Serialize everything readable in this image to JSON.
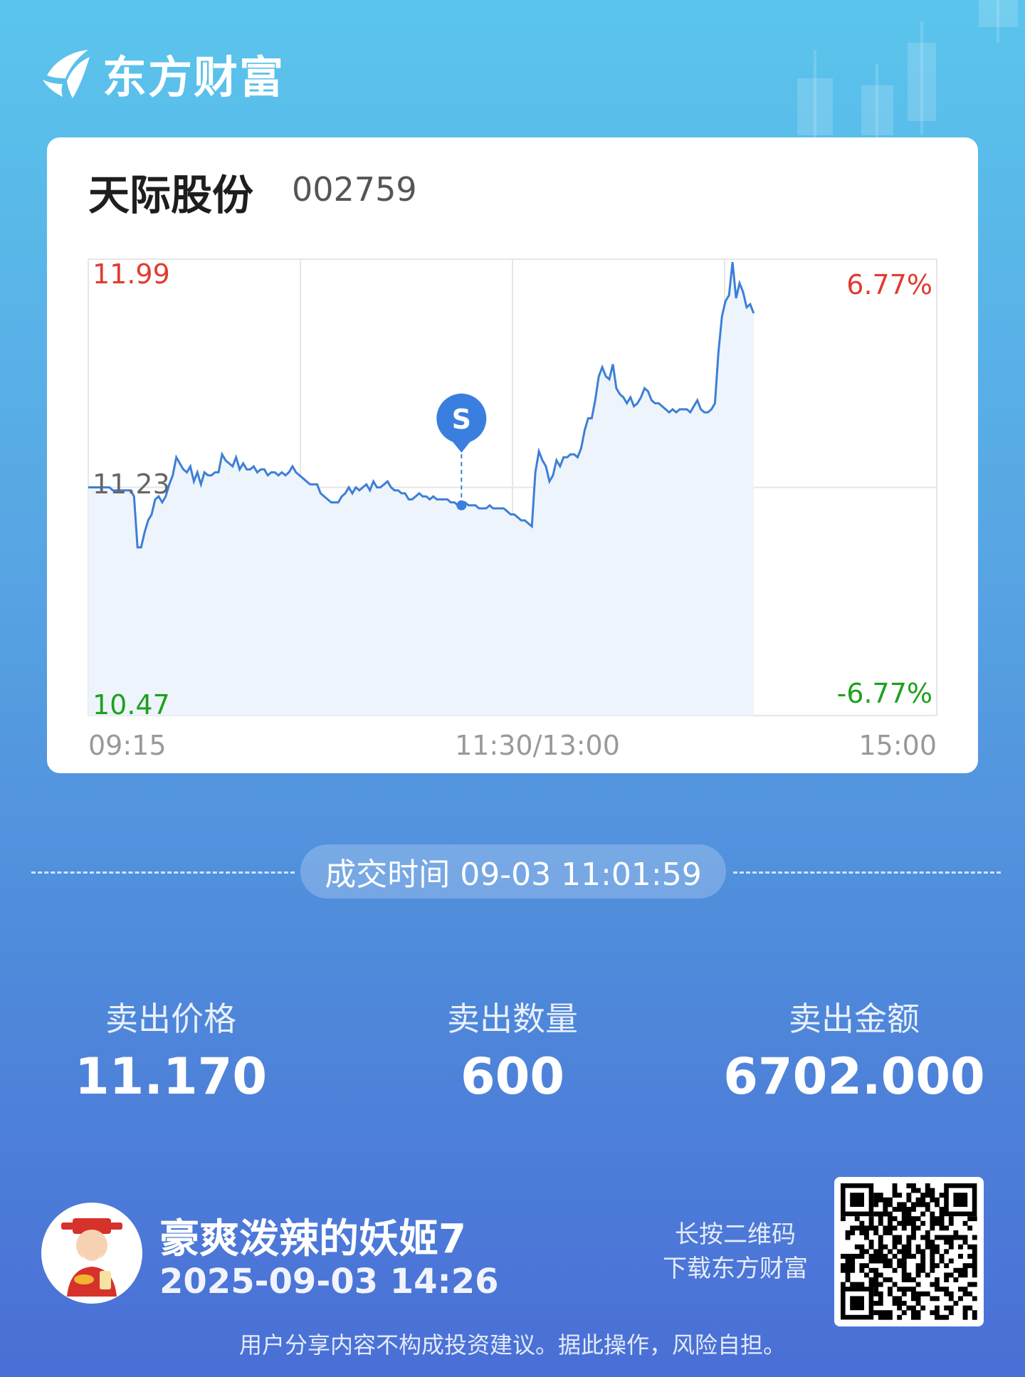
{
  "brand": {
    "name": "东方财富",
    "logo_icon": "eastmoney-logo-icon"
  },
  "stock": {
    "name": "天际股份",
    "code": "002759"
  },
  "chart_data": {
    "type": "line",
    "title": "",
    "y_max_label": "11.99",
    "y_mid_label": "11.23",
    "y_min_label": "10.47",
    "pct_max_label": "6.77%",
    "pct_min_label": "-6.77%",
    "x_tick_labels": [
      "09:15",
      "11:30/13:00",
      "15:00"
    ],
    "ylim": [
      10.47,
      11.99
    ],
    "reference_price": 11.23,
    "colors": {
      "line": "#3d7fd6",
      "fill": "#eef4fc",
      "up": "#e03c31",
      "down": "#1ea11e",
      "grid": "#e6e6e6"
    },
    "marker": {
      "label": "S",
      "time_index": 106,
      "price": 11.17,
      "color": "#3a7fe0"
    },
    "series": [
      {
        "values": [
          11.23,
          11.23,
          11.23,
          11.23,
          11.23,
          11.23,
          11.23,
          11.22,
          11.22,
          11.22,
          11.22,
          11.22,
          11.22,
          11.2,
          11.03,
          11.03,
          11.08,
          11.12,
          11.14,
          11.19,
          11.2,
          11.18,
          11.2,
          11.24,
          11.27,
          11.33,
          11.31,
          11.29,
          11.28,
          11.3,
          11.25,
          11.28,
          11.24,
          11.28,
          11.27,
          11.27,
          11.28,
          11.28,
          11.34,
          11.32,
          11.31,
          11.3,
          11.33,
          11.29,
          11.31,
          11.29,
          11.29,
          11.3,
          11.28,
          11.29,
          11.29,
          11.27,
          11.28,
          11.28,
          11.27,
          11.28,
          11.27,
          11.28,
          11.3,
          11.28,
          11.27,
          11.26,
          11.25,
          11.24,
          11.24,
          11.24,
          11.21,
          11.2,
          11.19,
          11.18,
          11.18,
          11.18,
          11.2,
          11.21,
          11.23,
          11.21,
          11.23,
          11.22,
          11.23,
          11.24,
          11.22,
          11.25,
          11.23,
          11.23,
          11.24,
          11.25,
          11.23,
          11.22,
          11.22,
          11.21,
          11.21,
          11.19,
          11.19,
          11.2,
          11.21,
          11.2,
          11.2,
          11.19,
          11.2,
          11.19,
          11.19,
          11.19,
          11.19,
          11.18,
          11.18,
          11.17,
          11.17,
          11.18,
          11.17,
          11.17,
          11.17,
          11.16,
          11.16,
          11.16,
          11.17,
          11.16,
          11.16,
          11.16,
          11.16,
          11.15,
          11.14,
          11.14,
          11.13,
          11.12,
          11.12,
          11.11,
          11.1,
          11.28,
          11.35,
          11.32,
          11.3,
          11.25,
          11.27,
          11.32,
          11.3,
          11.33,
          11.33,
          11.34,
          11.34,
          11.33,
          11.36,
          11.42,
          11.46,
          11.46,
          11.52,
          11.6,
          11.63,
          11.6,
          11.59,
          11.64,
          11.56,
          11.54,
          11.53,
          11.51,
          11.53,
          11.5,
          11.51,
          11.53,
          11.56,
          11.55,
          11.52,
          11.51,
          11.51,
          11.5,
          11.49,
          11.48,
          11.49,
          11.48,
          11.49,
          11.49,
          11.49,
          11.48,
          11.5,
          11.52,
          11.49,
          11.48,
          11.48,
          11.49,
          11.51,
          11.68,
          11.8,
          11.85,
          11.87,
          11.98,
          11.86,
          11.91,
          11.88,
          11.83,
          11.84,
          11.81
        ]
      }
    ]
  },
  "trade_time": "成交时间 09-03 11:01:59",
  "stats": [
    {
      "label": "卖出价格",
      "value": "11.170"
    },
    {
      "label": "卖出数量",
      "value": "600"
    },
    {
      "label": "卖出金额",
      "value": "6702.000"
    }
  ],
  "user": {
    "name": "豪爽泼辣的妖姬7",
    "share_time": "2025-09-03 14:26",
    "avatar_icon": "caishen-avatar-icon"
  },
  "qr": {
    "hint_line1": "长按二维码",
    "hint_line2": "下载东方财富",
    "icon": "qr-code-icon"
  },
  "disclaimer": "用户分享内容不构成投资建议。据此操作，风险自担。"
}
